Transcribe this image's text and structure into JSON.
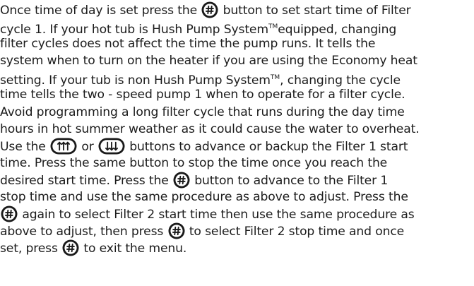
{
  "document": {
    "paragraph": {
      "line1_a": "Once time of day is set press the ",
      "line1_b": " button to set start time of Filter",
      "line2_a": "cycle 1. If your hot tub is Hush Pump System",
      "line2_tm": "TM",
      "line2_b": "equipped, changing",
      "line3": "filter cycles does not affect the time the pump runs. It tells the",
      "line4": "system when to turn on the heater if you are using the Economy heat",
      "line5_a": "setting. If your tub is non Hush Pump System",
      "line5_tm": "TM",
      "line5_b": ", changing the cycle",
      "line6": "time tells the two - speed pump 1 when to operate for a filter cycle.",
      "line7": "Avoid programming a long filter cycle that runs during the day time",
      "line8": "hours in hot summer weather as it could cause the water to overheat.",
      "line9_a": "Use the ",
      "line9_b": " or ",
      "line9_c": " buttons to advance or backup the Filter 1 start",
      "line10": "time. Press the same button to stop the time once you reach the",
      "line11_a": "desired start time. Press the ",
      "line11_b": " button to advance to the Filter 1",
      "line12": "stop time and use the same procedure as above to adjust. Press the",
      "line13_a": "",
      "line13_b": " again to select Filter 2 start time then use the same procedure as",
      "line14_a": "above to adjust, then press ",
      "line14_b": " to select Filter 2 stop time and once",
      "line15_a": "set, press ",
      "line15_b": " to exit the menu."
    },
    "icons": {
      "mode": "mode-button-icon",
      "warmer": "warmer-button-icon",
      "cooler": "cooler-button-icon"
    },
    "colors": {
      "text": "#1c1c1c",
      "icon": "#1a1a1a"
    }
  }
}
